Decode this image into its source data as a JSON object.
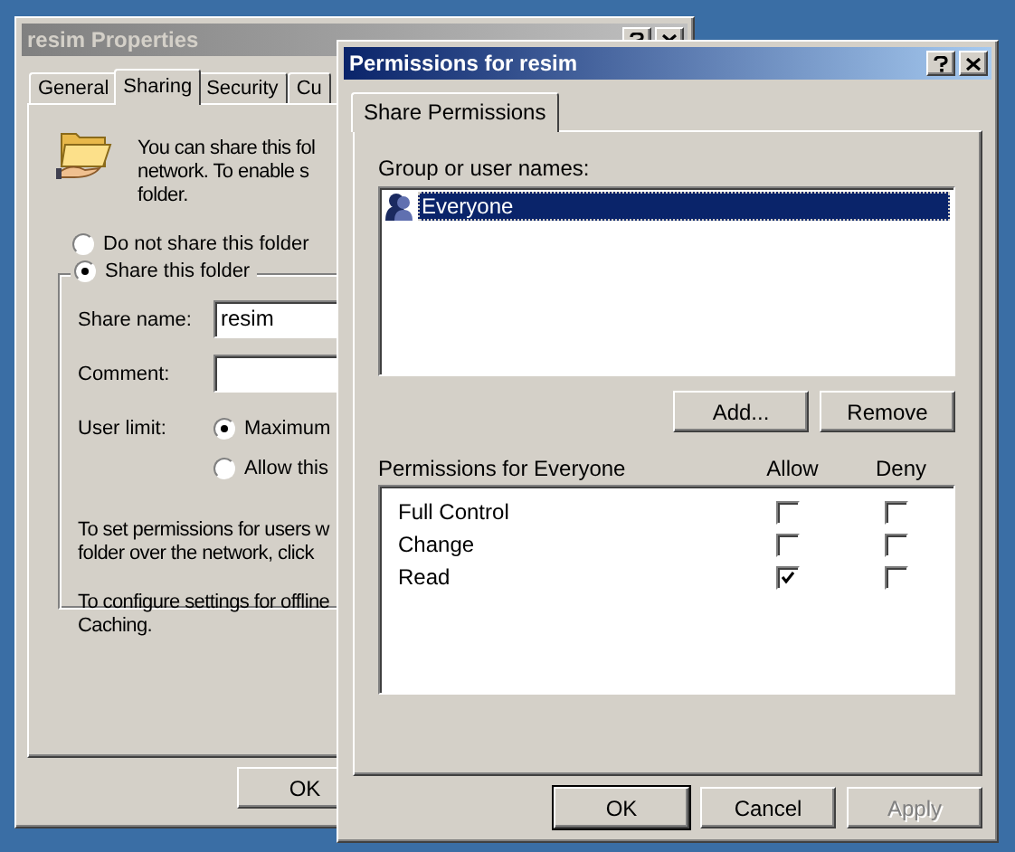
{
  "back_window": {
    "title": "resim Properties",
    "active": false,
    "tabs": [
      {
        "label": "General",
        "selected": false
      },
      {
        "label": "Sharing",
        "selected": true
      },
      {
        "label": "Security",
        "selected": false
      },
      {
        "label": "Cu",
        "selected": false
      }
    ],
    "intro": [
      "You can share this fol",
      "network.  To enable s",
      "folder."
    ],
    "share_options": [
      {
        "label": "Do not share this folder",
        "selected": false
      },
      {
        "label": "Share this folder",
        "selected": true
      }
    ],
    "share_name": {
      "label": "Share name:",
      "value": "resim"
    },
    "comment": {
      "label": "Comment:"
    },
    "user_limit": {
      "label": "User limit:",
      "options": [
        {
          "label": "Maximum",
          "selected": true
        },
        {
          "label": "Allow this",
          "selected": false
        }
      ]
    },
    "notes": [
      [
        "To set permissions for users w",
        "folder over the network, click"
      ],
      [
        "To configure settings for offline",
        "Caching."
      ]
    ],
    "buttons": [
      "OK"
    ]
  },
  "dialog": {
    "title": "Permissions for resim",
    "active": true,
    "tabs": [
      {
        "label": "Share Permissions",
        "selected": true
      }
    ],
    "group_label": "Group or user names:",
    "users": [
      {
        "name": "Everyone",
        "selected": true
      }
    ],
    "user_buttons": [
      "Add...",
      "Remove"
    ],
    "permissions_label": "Permissions for Everyone",
    "columns": [
      "Allow",
      "Deny"
    ],
    "permissions": [
      {
        "name": "Full Control",
        "allow": false,
        "deny": false
      },
      {
        "name": "Change",
        "allow": false,
        "deny": false
      },
      {
        "name": "Read",
        "allow": true,
        "deny": false
      }
    ],
    "buttons": [
      {
        "label": "OK",
        "disabled": false
      },
      {
        "label": "Cancel",
        "disabled": false
      },
      {
        "label": "Apply",
        "disabled": true
      }
    ]
  }
}
